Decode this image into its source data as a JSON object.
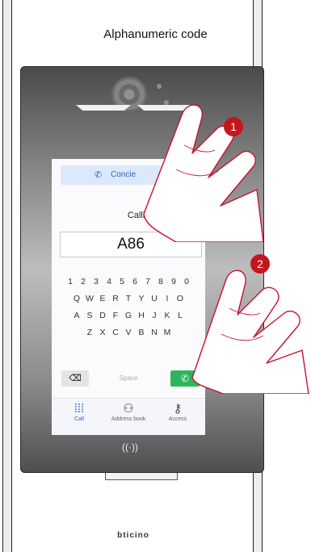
{
  "header": {
    "title": "Alphanumeric code"
  },
  "screen": {
    "concierge_label": "Concie",
    "calling_label": "Calling c",
    "code_value": "A86",
    "keyboard_rows": [
      [
        "1",
        "2",
        "3",
        "4",
        "5",
        "6",
        "7",
        "8",
        "9",
        "0"
      ],
      [
        "Q",
        "W",
        "E",
        "R",
        "T",
        "Y",
        "U",
        "I",
        "O"
      ],
      [
        "A",
        "S",
        "D",
        "F",
        "G",
        "H",
        "J",
        "K",
        "L"
      ],
      [
        "Z",
        "X",
        "C",
        "V",
        "B",
        "N",
        "M"
      ]
    ],
    "space_label": "Space",
    "nav": {
      "call": "Call",
      "address_book": "Address book",
      "access": "Access"
    }
  },
  "steps": {
    "step1": "1",
    "step2": "2"
  },
  "brand": {
    "logo_text": "bticino"
  },
  "colors": {
    "accent": "#2a64c4",
    "call_green": "#2db55d",
    "step_red": "#c4161c"
  },
  "icons": [
    "phone-icon",
    "backspace-icon",
    "keypad-icon",
    "address-book-icon",
    "key-icon",
    "nfc-icon",
    "pointing-hand-icon"
  ]
}
